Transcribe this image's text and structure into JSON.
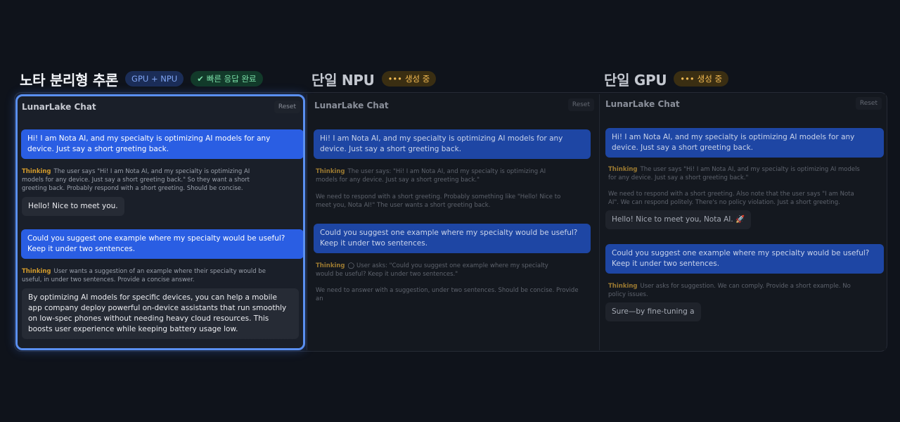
{
  "columns": [
    {
      "title": "노타 분리형 추론",
      "badges": [
        {
          "label": "GPU + NPU",
          "kind": "blue"
        },
        {
          "label": "빠른 응답 완료",
          "kind": "green",
          "icon": "check-icon"
        }
      ],
      "panel": {
        "title": "LunarLake Chat",
        "reset_label": "Reset",
        "messages": [
          {
            "role": "user",
            "text": "Hi! I am Nota AI, and my specialty is optimizing AI models for any device. Just say a short greeting back."
          },
          {
            "role": "thinking",
            "label": "Thinking",
            "text": "The user says \"Hi! I am Nota AI, and my specialty is optimizing AI models for any device. Just say a short greeting back.\" So they want a short greeting back. Probably respond with a short greeting. Should be concise."
          },
          {
            "role": "assistant",
            "text": "Hello! Nice to meet you."
          },
          {
            "role": "user",
            "text": "Could you suggest one example where my specialty would be useful? Keep it under two sentences."
          },
          {
            "role": "thinking",
            "label": "Thinking",
            "text": "User wants a suggestion of an example where their specialty would be useful, in under two sentences. Provide a concise answer."
          },
          {
            "role": "assistant",
            "text": "By optimizing AI models for specific devices, you can help a mobile app company deploy powerful on-device assistants that run smoothly on low-spec phones without needing heavy cloud resources. This boosts user experience while keeping battery usage low."
          }
        ]
      }
    },
    {
      "title": "단일 NPU",
      "badges": [
        {
          "label": "생성 중",
          "kind": "amber",
          "icon": "dots-icon"
        }
      ],
      "panel": {
        "title": "LunarLake Chat",
        "reset_label": "Reset",
        "messages": [
          {
            "role": "user",
            "text": "Hi! I am Nota AI, and my specialty is optimizing AI models for any device. Just say a short greeting back."
          },
          {
            "role": "thinking",
            "label": "Thinking",
            "text": "The user says: \"Hi! I am Nota AI, and my specialty is optimizing AI models for any device. Just say a short greeting back.\""
          },
          {
            "role": "thinking-cont",
            "text": "We need to respond with a short greeting. Probably something like \"Hello! Nice to meet you, Nota AI!\" The user wants a short greeting back."
          },
          {
            "role": "user",
            "text": "Could you suggest one example where my specialty would be useful? Keep it under two sentences."
          },
          {
            "role": "thinking",
            "label": "Thinking",
            "text": "User asks: \"Could you suggest one example where my specialty would be useful? Keep it under two sentences.\""
          },
          {
            "role": "thinking-cont",
            "text": "We need to answer with a suggestion, under two sentences. Should be concise. Provide an"
          }
        ]
      }
    },
    {
      "title": "단일 GPU",
      "badges": [
        {
          "label": "생성 중",
          "kind": "amber",
          "icon": "dots-icon"
        }
      ],
      "panel": {
        "title": "LunarLake Chat",
        "reset_label": "Reset",
        "messages": [
          {
            "role": "user",
            "text": "Hi! I am Nota AI, and my specialty is optimizing AI models for any device. Just say a short greeting back."
          },
          {
            "role": "thinking",
            "label": "Thinking",
            "text": "The user says \"Hi! I am Nota AI, and my specialty is optimizing AI models for any device. Just say a short greeting back.\""
          },
          {
            "role": "thinking-cont",
            "text": "We need to respond with a short greeting. Also note that the user says \"I am Nota AI\". We can respond politely. There's no policy violation. Just a short greeting."
          },
          {
            "role": "assistant",
            "text": "Hello! Nice to meet you, Nota AI. 🚀"
          },
          {
            "role": "user",
            "text": "Could you suggest one example where my specialty would be useful? Keep it under two sentences."
          },
          {
            "role": "thinking",
            "label": "Thinking",
            "text": "User asks for suggestion. We can comply. Provide a short example. No policy issues."
          },
          {
            "role": "assistant",
            "text": "Sure—by fine-tuning a"
          }
        ]
      }
    }
  ]
}
